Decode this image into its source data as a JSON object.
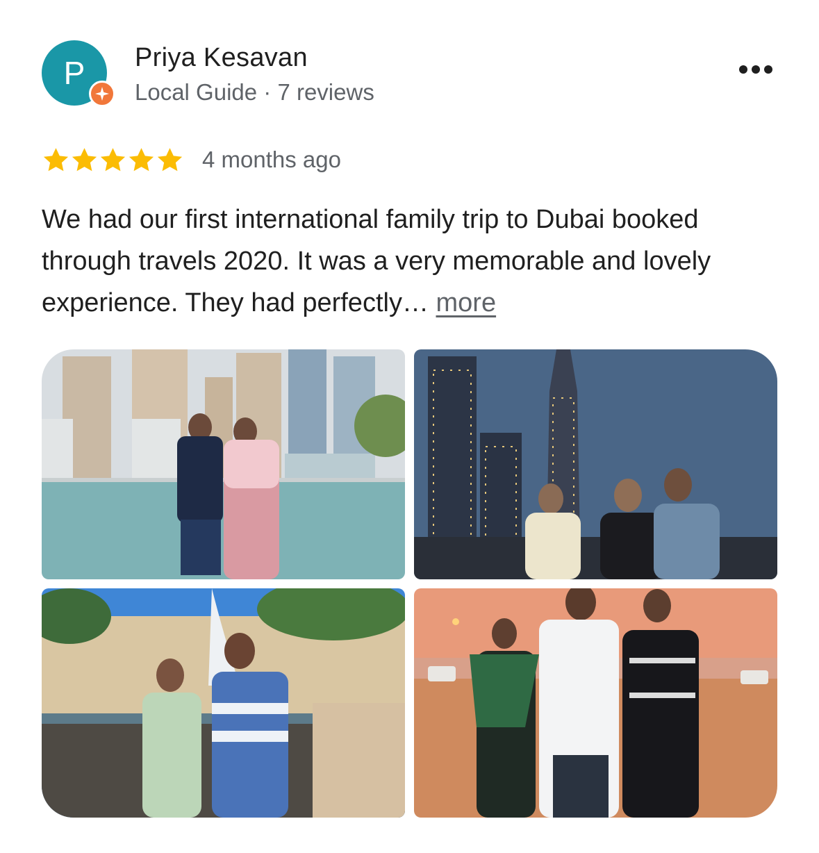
{
  "reviewer": {
    "initial": "P",
    "name": "Priya Kesavan",
    "meta": "Local Guide · 7 reviews",
    "avatar_color": "#1a97a7",
    "badge_color": "#f1773a"
  },
  "menu_icon": "more-horizontal-icon",
  "rating": {
    "stars": 5,
    "max": 5,
    "star_color": "#fbbc04",
    "time": "4 months ago"
  },
  "review": {
    "text": "We had our first international family trip to Dubai booked through travels 2020. It was a very memorable and lovely experience. They had perfectly…",
    "more_label": "more"
  },
  "photos": [
    {
      "subject": "marina-couple-photo"
    },
    {
      "subject": "burj-khalifa-night-photo"
    },
    {
      "subject": "burj-al-arab-couple-photo"
    },
    {
      "subject": "desert-sunset-family-photo"
    }
  ]
}
